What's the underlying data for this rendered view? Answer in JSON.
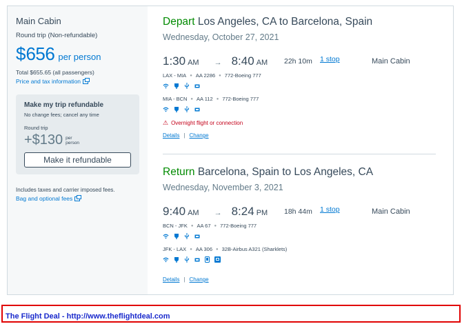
{
  "summary": {
    "cabin": "Main Cabin",
    "trip_type": "Round trip (Non-refundable)",
    "currency": "$",
    "price": "656",
    "per_person": "per person",
    "total": "Total $655.65 (all passengers)",
    "price_tax_link": "Price and tax information",
    "refundable": {
      "title": "Make my trip refundable",
      "subtitle": "No change fees; cancel any time",
      "round_trip": "Round trip",
      "price": "+$130",
      "per": "per",
      "person": "person",
      "button": "Make it refundable"
    },
    "includes": "Includes taxes and carrier imposed fees.",
    "bag_link": "Bag and optional fees"
  },
  "depart": {
    "verb": "Depart",
    "route": "Los Angeles, CA to Barcelona, Spain",
    "date": "Wednesday, October 27, 2021",
    "dep_time": "1:30",
    "dep_ampm": "AM",
    "arr_time": "8:40",
    "arr_ampm": "AM",
    "duration": "22h 10m",
    "stops": "1 stop",
    "cabin": "Main Cabin",
    "segments": [
      {
        "route": "LAX - MIA",
        "flight": "AA 2286",
        "aircraft": "772-Boeing 777"
      },
      {
        "route": "MIA - BCN",
        "flight": "AA 112",
        "aircraft": "772-Boeing 777"
      }
    ],
    "warning": "Overnight flight or connection",
    "details": "Details",
    "change": "Change"
  },
  "return": {
    "verb": "Return",
    "route": "Barcelona, Spain to Los Angeles, CA",
    "date": "Wednesday, November 3, 2021",
    "dep_time": "9:40",
    "dep_ampm": "AM",
    "arr_time": "8:24",
    "arr_ampm": "PM",
    "duration": "18h 44m",
    "stops": "1 stop",
    "cabin": "Main Cabin",
    "segments": [
      {
        "route": "BCN - JFK",
        "flight": "AA 67",
        "aircraft": "772-Boeing 777"
      },
      {
        "route": "JFK - LAX",
        "flight": "AA 306",
        "aircraft": "32B-Airbus A321 (Sharklets)"
      }
    ],
    "details": "Details",
    "change": "Change"
  },
  "common": {
    "arrow": "→",
    "link_sep": "|",
    "dot": "●",
    "warn_glyph": "⚠"
  },
  "icons": {
    "amenities": [
      "wifi-icon",
      "power-icon",
      "usb-icon",
      "entertainment-icon",
      "device-entertainment-icon",
      "in-seat-screen-icon"
    ],
    "external": "external-link-icon"
  },
  "colors": {
    "accent": "#0078d2",
    "text": "#36495a",
    "depart_verb": "#008a00",
    "warning": "#c30019",
    "banner_border": "#e00000",
    "banner_text": "#1a2acc"
  },
  "banner": {
    "text": "The Flight Deal - http://www.theflightdeal.com"
  }
}
